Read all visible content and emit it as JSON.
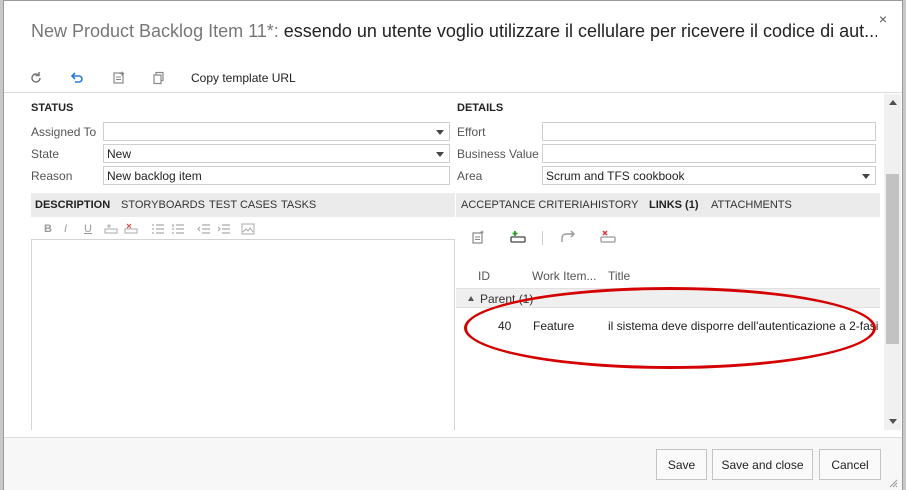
{
  "dialog": {
    "title_prefix": "New Product Backlog Item 11*:",
    "title_text": " essendo un utente voglio utilizzare il cellulare per ricevere il codice di aut...",
    "close": "×"
  },
  "toolbar": {
    "refresh_icon": "refresh-icon",
    "undo_icon": "undo-icon",
    "template_icon": "template-icon",
    "copy_icon": "copy-icon",
    "copy_template_url": "Copy template URL"
  },
  "status": {
    "heading": "STATUS",
    "assigned_to_label": "Assigned To",
    "assigned_to_value": "",
    "state_label": "State",
    "state_value": "New",
    "reason_label": "Reason",
    "reason_value": "New backlog item"
  },
  "details": {
    "heading": "DETAILS",
    "effort_label": "Effort",
    "effort_value": "",
    "business_value_label": "Business Value",
    "business_value_value": "",
    "area_label": "Area",
    "area_value": "Scrum and TFS cookbook"
  },
  "left_tabs": [
    "DESCRIPTION",
    "STORYBOARDS",
    "TEST CASES",
    "TASKS"
  ],
  "right_tabs": [
    "ACCEPTANCE CRITERIA",
    "HISTORY",
    "LINKS (1)",
    "ATTACHMENTS"
  ],
  "rte": {
    "bold": "B",
    "italic": "I",
    "underline": "U"
  },
  "links": {
    "columns": [
      "ID",
      "Work Item...",
      "Title"
    ],
    "group_label": "Parent (1)",
    "rows": [
      {
        "id": "40",
        "type": "Feature",
        "title": "il sistema deve disporre dell'autenticazione a 2-fasi"
      }
    ]
  },
  "annotation": {
    "color": "#d40000"
  },
  "footer": {
    "save": "Save",
    "save_and_close": "Save and close",
    "cancel": "Cancel"
  }
}
